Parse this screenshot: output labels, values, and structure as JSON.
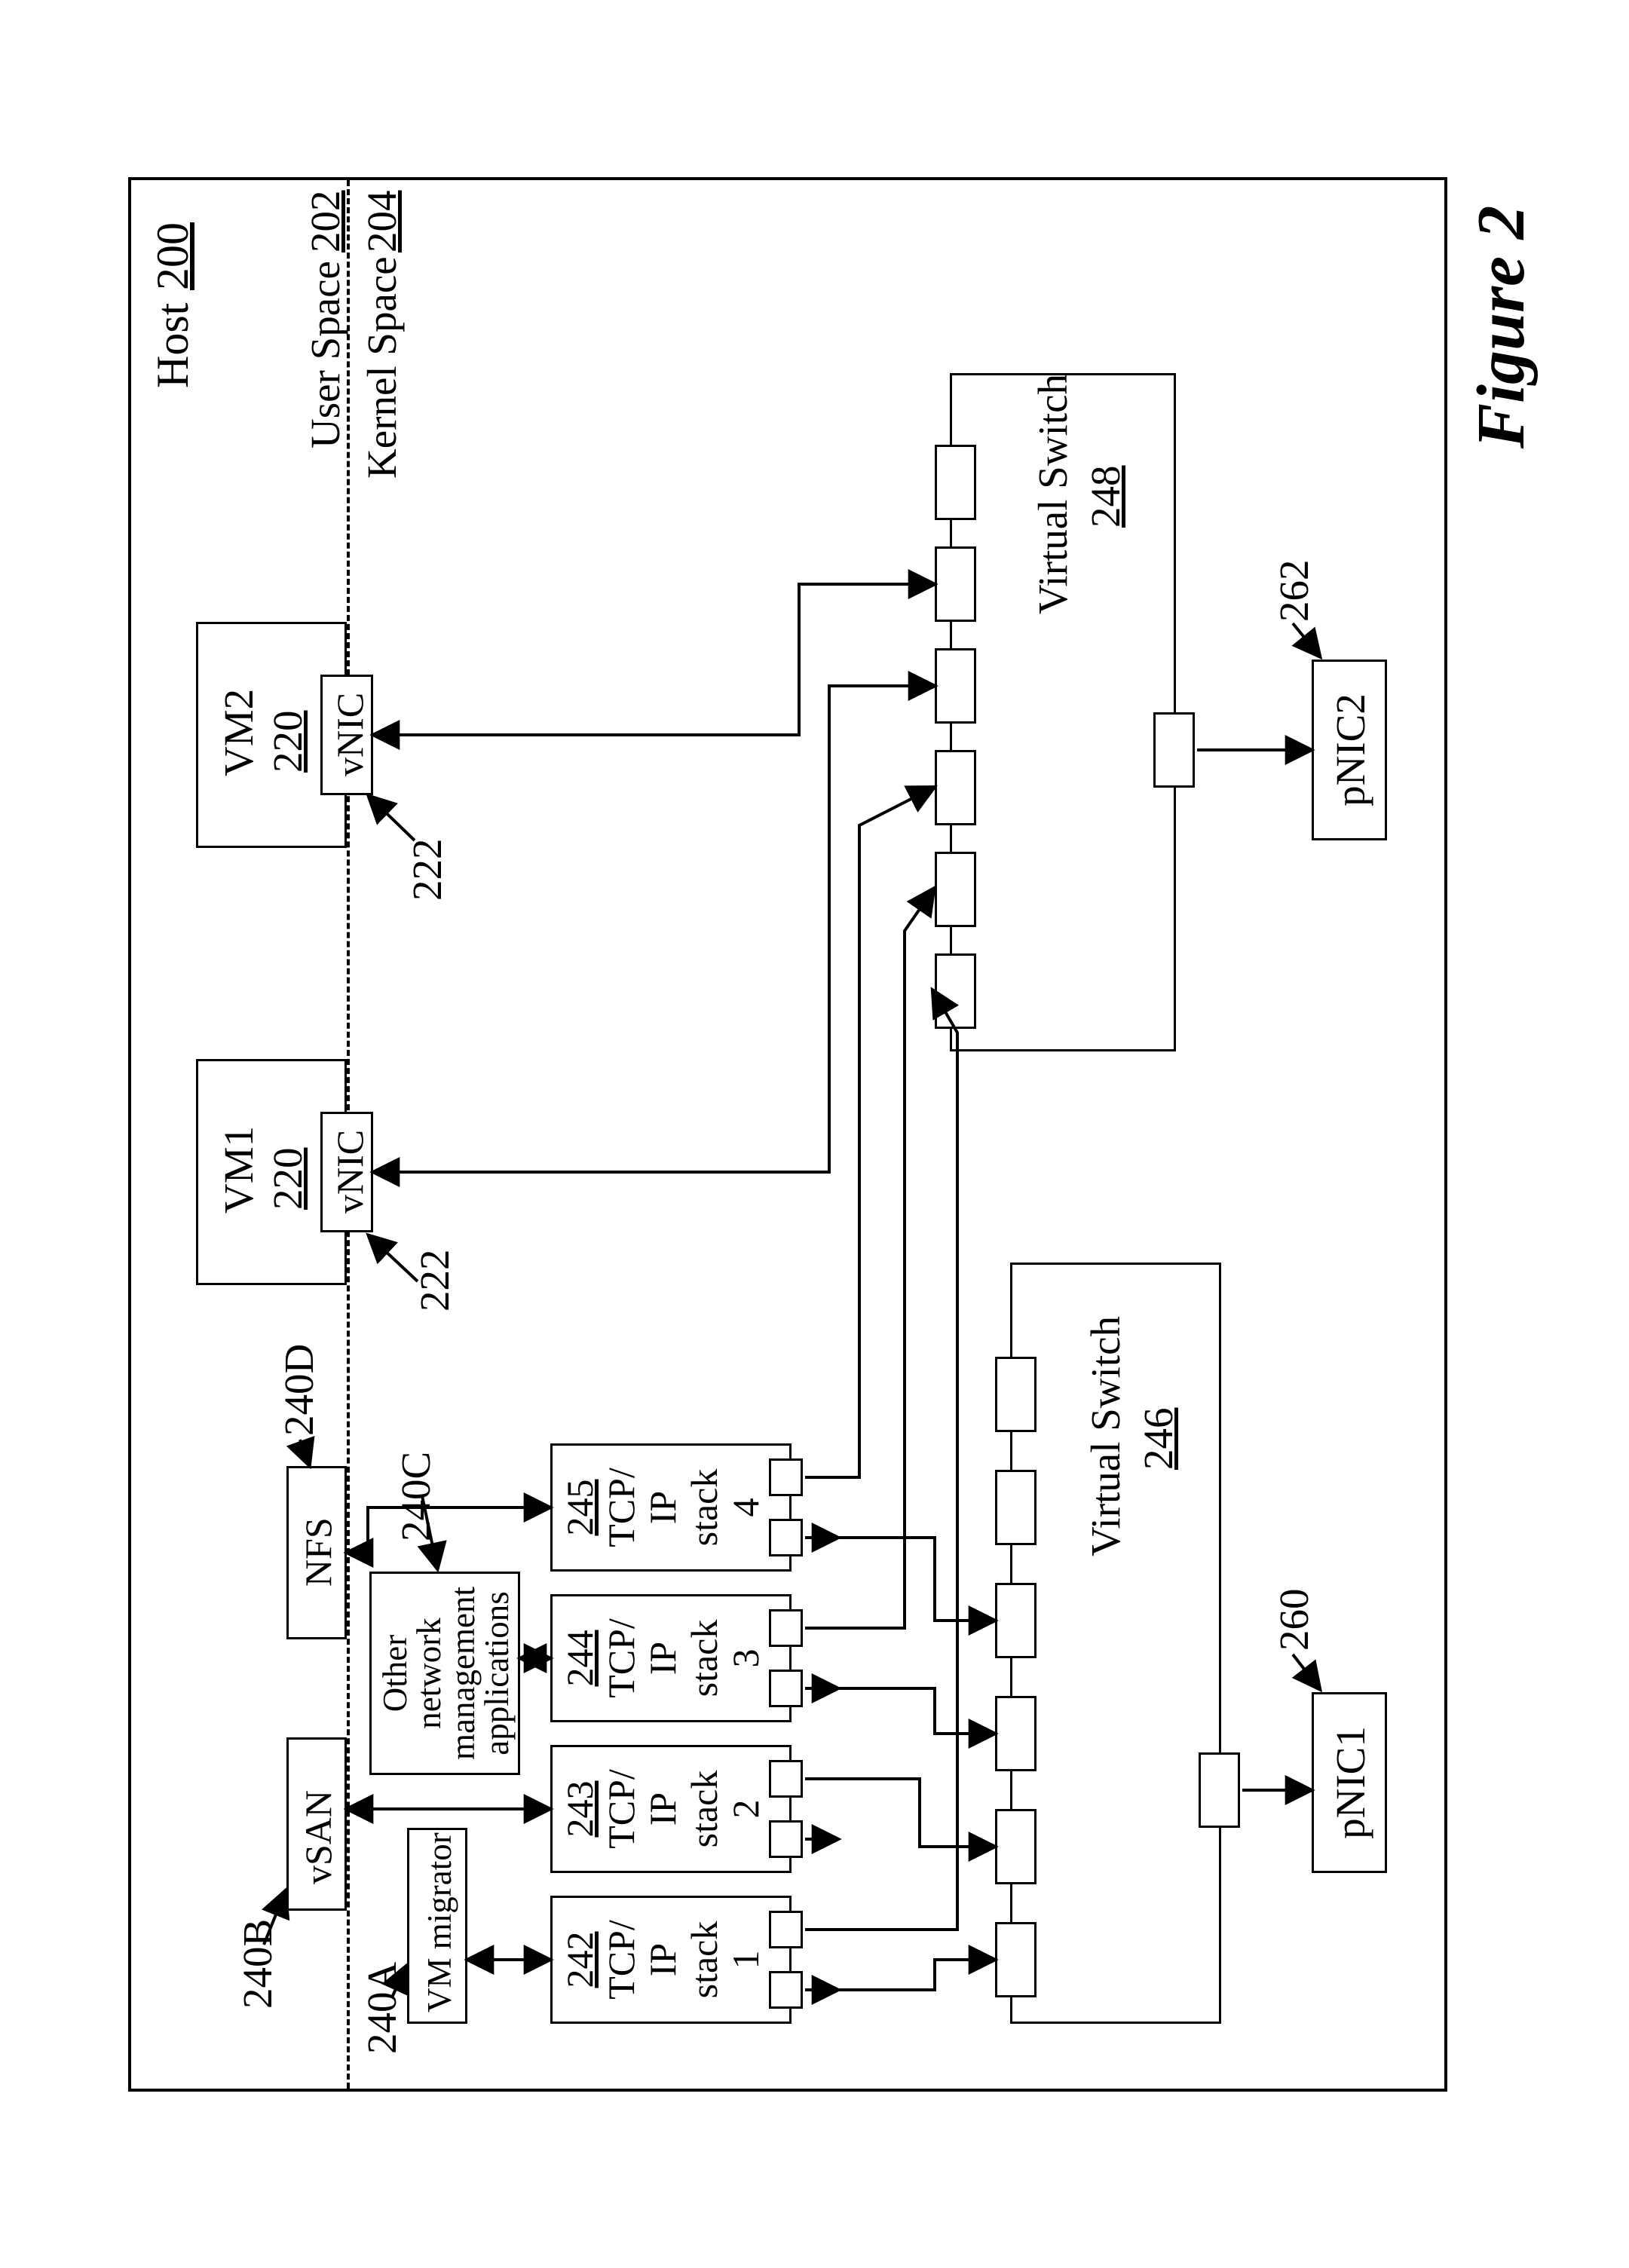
{
  "host": {
    "label": "Host",
    "ref": "200"
  },
  "user_space": {
    "label": "User Space",
    "ref": "202"
  },
  "kernel_space": {
    "label": "Kernel Space",
    "ref": "204"
  },
  "vm1": {
    "label": "VM1",
    "ref": "220",
    "vnic": "vNIC",
    "vnic_ref": "222"
  },
  "vm2": {
    "label": "VM2",
    "ref": "220",
    "vnic": "vNIC",
    "vnic_ref": "222"
  },
  "apps": {
    "vm_migrator": {
      "label": "VM migrator",
      "ref": "240A"
    },
    "vsan": {
      "label": "vSAN",
      "ref": "240B"
    },
    "other_net_mgmt": {
      "label_l1": "Other",
      "label_l2": "network",
      "label_l3": "management",
      "label_l4": "applications",
      "ref": "240C"
    },
    "nfs": {
      "label": "NFS",
      "ref": "240D"
    }
  },
  "stacks": {
    "prefix_l1": "TCP/",
    "prefix_l2": "IP",
    "prefix_l3": "stack",
    "s1": {
      "num": "1",
      "ref": "242"
    },
    "s2": {
      "num": "2",
      "ref": "243"
    },
    "s3": {
      "num": "3",
      "ref": "244"
    },
    "s4": {
      "num": "4",
      "ref": "245"
    }
  },
  "switches": {
    "vs1": {
      "label": "Virtual Switch",
      "ref": "246"
    },
    "vs2": {
      "label": "Virtual Switch",
      "ref": "248"
    }
  },
  "pnics": {
    "p1": {
      "label": "pNIC1",
      "ref": "260"
    },
    "p2": {
      "label": "pNIC2",
      "ref": "262"
    }
  },
  "figure": {
    "label": "Figure 2"
  }
}
